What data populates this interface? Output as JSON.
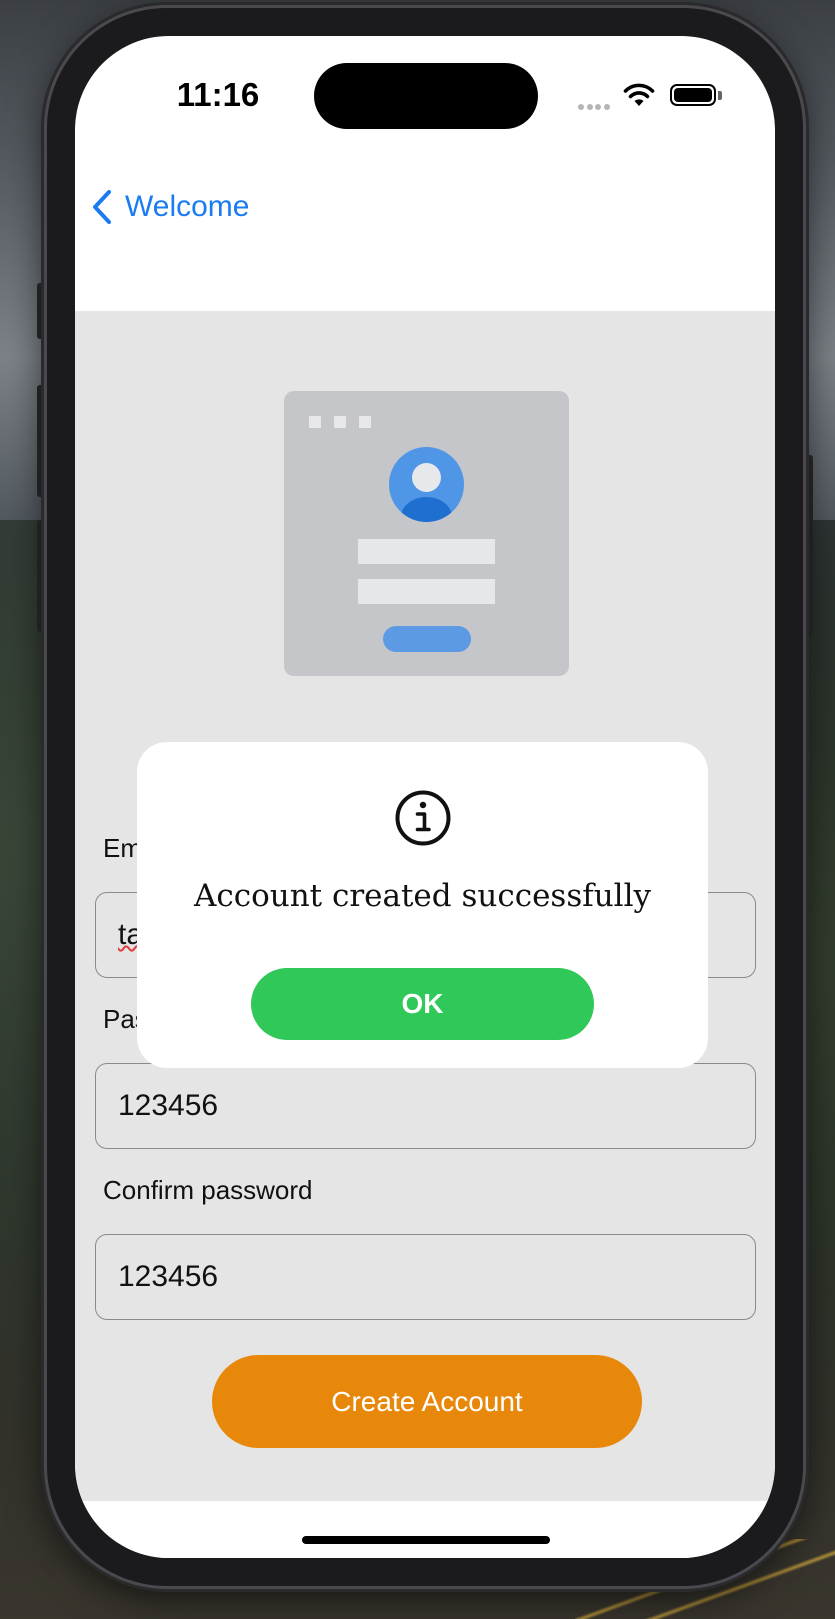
{
  "status_bar": {
    "time": "11:16"
  },
  "nav": {
    "back_label": "Welcome"
  },
  "form": {
    "email_label": "Em",
    "email_value": "ta",
    "password_label": "Pas",
    "password_value": "123456",
    "confirm_label": "Confirm password",
    "confirm_value": "123456",
    "create_button": "Create Account"
  },
  "alert": {
    "icon": "info-circle-icon",
    "message": "Account created successfully",
    "ok_button": "OK"
  },
  "colors": {
    "accent_blue": "#1a7cf0",
    "create_button": "#e8880a",
    "ok_button": "#31c85a",
    "content_bg": "#e5e5e5"
  }
}
